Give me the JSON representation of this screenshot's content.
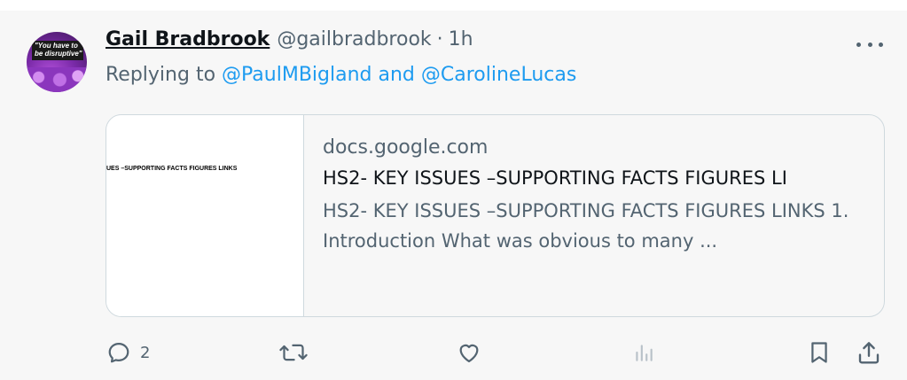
{
  "tweet": {
    "author_name": "Gail Bradbrook",
    "handle": "@gailbradbrook",
    "separator": "·",
    "time": "1h",
    "avatar_text": "\"You have to be disruptive\"",
    "replying_prefix": "Replying to",
    "mention_1": "@PaulMBigland",
    "mention_and": "and",
    "mention_2": "@CarolineLucas"
  },
  "card": {
    "thumbnail_text": "UES –SUPPORTING FACTS FIGURES LINKS",
    "domain": "docs.google.com",
    "title": "HS2- KEY ISSUES –SUPPORTING FACTS FIGURES LI",
    "description": "HS2- KEY ISSUES –SUPPORTING FACTS FIGURES LINKS 1. Introduction What was obvious to many ..."
  },
  "actions": {
    "reply_count": "2",
    "icons": [
      "reply-icon",
      "retweet-icon",
      "like-icon",
      "views-icon",
      "bookmark-icon",
      "share-icon"
    ]
  },
  "colors": {
    "link": "#1d9bf0",
    "secondary_text": "#536471",
    "primary_text": "#0f1419",
    "border": "#cfd9de"
  }
}
